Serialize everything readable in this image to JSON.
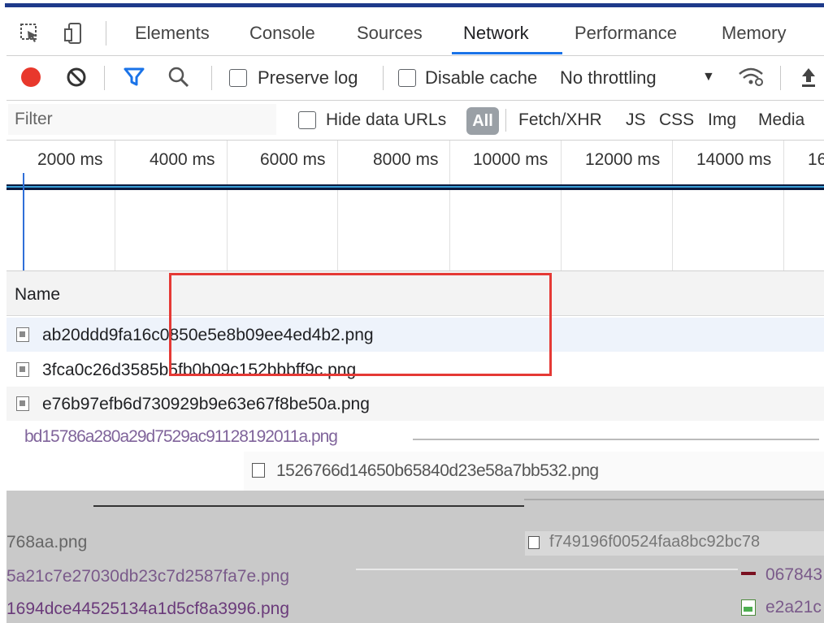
{
  "tabs": {
    "items": [
      "Elements",
      "Console",
      "Sources",
      "Network",
      "Performance",
      "Memory"
    ],
    "active": "Network"
  },
  "toolbar": {
    "preserve_log": "Preserve log",
    "disable_cache": "Disable cache",
    "throttling": "No throttling"
  },
  "filter": {
    "placeholder": "Filter",
    "hide_data_urls": "Hide data URLs",
    "all_label": "All",
    "types": [
      "Fetch/XHR",
      "JS",
      "CSS",
      "Img",
      "Media"
    ]
  },
  "overview": {
    "ticks": [
      "2000 ms",
      "4000 ms",
      "6000 ms",
      "8000 ms",
      "10000 ms",
      "12000 ms",
      "14000 ms",
      "16"
    ]
  },
  "table": {
    "name_header": "Name",
    "rows": [
      "ab20ddd9fa16c0850e5e8b09ee4ed4b2.png",
      "3fca0c26d3585b5fb0b09c152bbbff9c.png",
      "e76b97efb6d730929b9e63e67f8be50a.png"
    ]
  },
  "glitch": {
    "row1": "bd15786a280a29d7529ac91128192011a.png",
    "row2": "1526766d14650b65840d23e58a7bb532.png",
    "row3_left": "768aa.png",
    "row3_right": "f749196f00524faa8bc92bc78",
    "row4_left": "5a21c7e27030db23c7d2587fa7e.png",
    "row4_right": "067843",
    "row5_left": "1694dce44525134a1d5cf8a3996.png",
    "row5_right": "e2a21c"
  },
  "colors": {
    "record": "#e8382c",
    "active_tab_underline": "#1a73e8",
    "highlight_box": "#e53935",
    "timeline": "#0a1a3f"
  }
}
